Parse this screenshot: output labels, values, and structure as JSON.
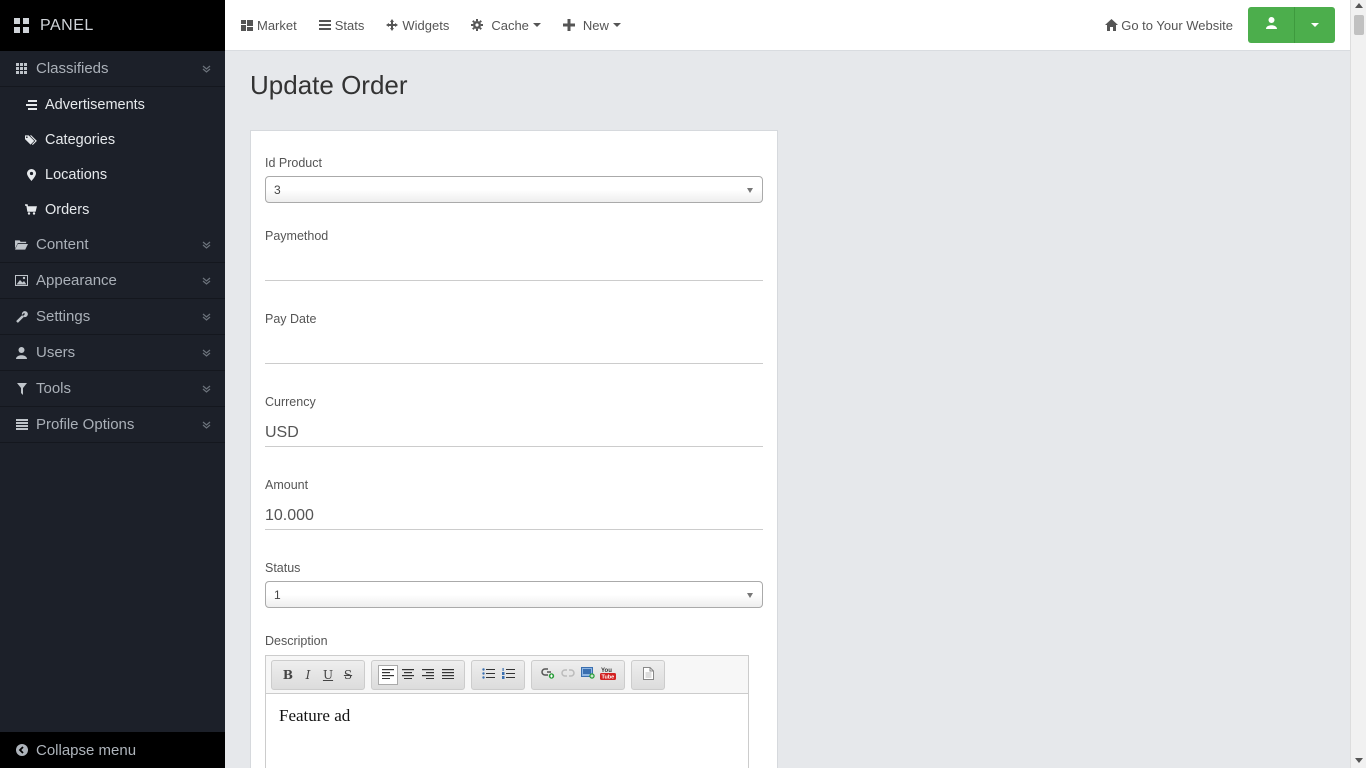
{
  "brand": {
    "title": "PANEL"
  },
  "sidebar": {
    "sections": [
      {
        "label": "Classifieds",
        "icon": "grid-icon",
        "expanded": true,
        "children": [
          {
            "label": "Advertisements",
            "icon": "list-icon"
          },
          {
            "label": "Categories",
            "icon": "tags-icon"
          },
          {
            "label": "Locations",
            "icon": "map-marker-icon"
          },
          {
            "label": "Orders",
            "icon": "shopping-cart-icon"
          }
        ]
      },
      {
        "label": "Content",
        "icon": "folder-icon"
      },
      {
        "label": "Appearance",
        "icon": "picture-icon"
      },
      {
        "label": "Settings",
        "icon": "wrench-icon"
      },
      {
        "label": "Users",
        "icon": "user-icon"
      },
      {
        "label": "Tools",
        "icon": "filter-icon"
      },
      {
        "label": "Profile Options",
        "icon": "list-icon"
      }
    ],
    "collapse_label": "Collapse menu"
  },
  "topbar": {
    "items": [
      {
        "label": "Market",
        "icon": "dashboard-icon"
      },
      {
        "label": "Stats",
        "icon": "align-justify-icon"
      },
      {
        "label": "Widgets",
        "icon": "move-icon"
      },
      {
        "label": "Cache",
        "icon": "cog-icon",
        "dropdown": true
      },
      {
        "label": "New",
        "icon": "plus-icon",
        "dropdown": true
      }
    ],
    "goto_label": "Go to Your Website",
    "accent": "#4cae4c"
  },
  "page": {
    "title": "Update Order"
  },
  "form": {
    "id_product": {
      "label": "Id Product",
      "value": "3"
    },
    "paymethod": {
      "label": "Paymethod",
      "value": ""
    },
    "pay_date": {
      "label": "Pay Date",
      "value": ""
    },
    "currency": {
      "label": "Currency",
      "value": "USD"
    },
    "amount": {
      "label": "Amount",
      "value": "10.000"
    },
    "status": {
      "label": "Status",
      "value": "1"
    },
    "description": {
      "label": "Description",
      "value": "Feature ad"
    }
  }
}
